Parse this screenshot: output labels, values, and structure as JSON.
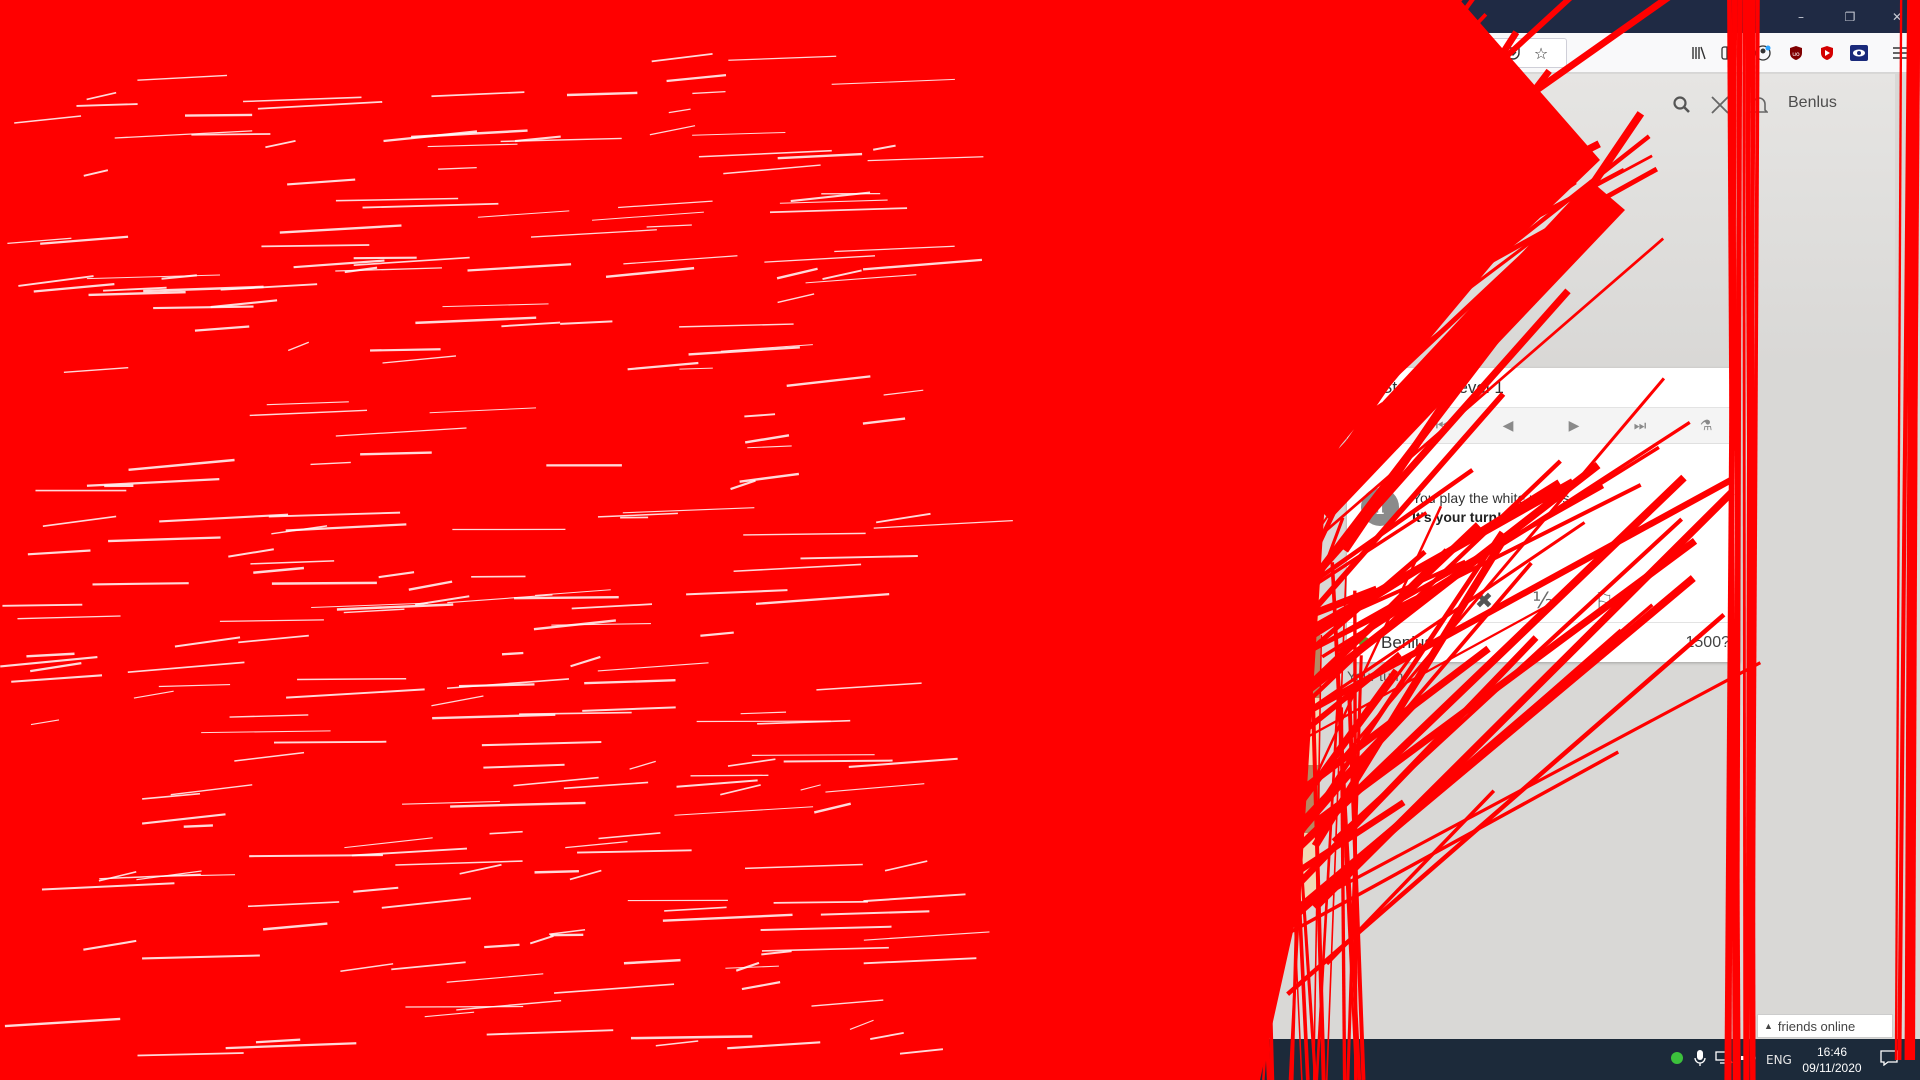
{
  "browser": {
    "window_buttons": [
      "–",
      "❐",
      "✕"
    ],
    "toolbar_icons": [
      "more-icon",
      "pocket-icon",
      "bookmark-star-icon",
      "library-icon",
      "sidebar-icon",
      "account-icon",
      "ublock-icon",
      "ublock-origin-icon",
      "eye-extension-icon",
      "menu-icon"
    ],
    "more_glyph": "•••",
    "star_glyph": "☆"
  },
  "header": {
    "username": "Benlus",
    "icons": [
      "search-icon",
      "swords-icon",
      "bell-icon"
    ]
  },
  "game_panel": {
    "opponent": "Stockfish level 1",
    "controls": [
      "⏮",
      "◀",
      "▶",
      "⏭",
      "⚗"
    ],
    "info_icon_glyph": "i",
    "message_line1": "You play the white pieces",
    "message_line2": "It's your turn!",
    "actions": {
      "abort": "✖",
      "draw": "½",
      "resign": "⚐"
    },
    "player": "Benlus",
    "rating": "1500?"
  },
  "turn_status": "Your turn",
  "friends_bar": "friends online",
  "taskbar": {
    "language": "ENG",
    "time": "16:46",
    "date": "09/11/2020"
  },
  "board": {
    "white_pieces_rank2": [
      "♙",
      "♙",
      "♙",
      "♙",
      "♙",
      "♙",
      "♙",
      "♙"
    ],
    "white_pieces_rank1": [
      "♖",
      "♘",
      "♗",
      "♕",
      "♔",
      "♗",
      "♘",
      "♖"
    ]
  },
  "colors": {
    "overlay": "#ff0000",
    "titlebar": "#1f2a44",
    "taskbar": "#1c2a3a",
    "online": "#629924",
    "light_square": "#f0d9b5",
    "dark_square": "#b58863"
  }
}
